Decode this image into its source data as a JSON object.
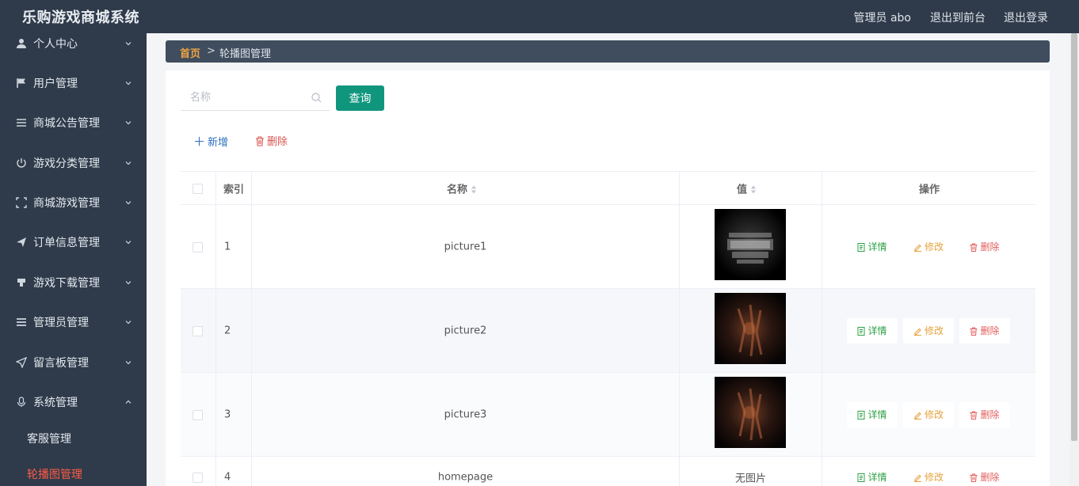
{
  "header": {
    "app_title": "乐购游戏商城系统",
    "admin_label": "管理员 abo",
    "front_link": "退出到前台",
    "logout_link": "退出登录"
  },
  "sidebar": {
    "items": [
      {
        "label": "个人中心",
        "icon": "user-icon"
      },
      {
        "label": "用户管理",
        "icon": "flag-icon"
      },
      {
        "label": "商城公告管理",
        "icon": "list-icon"
      },
      {
        "label": "游戏分类管理",
        "icon": "power-icon"
      },
      {
        "label": "商城游戏管理",
        "icon": "fullscreen-icon"
      },
      {
        "label": "订单信息管理",
        "icon": "send-icon"
      },
      {
        "label": "游戏下载管理",
        "icon": "download-icon"
      },
      {
        "label": "管理员管理",
        "icon": "menu-icon"
      },
      {
        "label": "留言板管理",
        "icon": "navigation-icon"
      },
      {
        "label": "系统管理",
        "icon": "microphone-icon",
        "expanded": true
      }
    ],
    "sub_items": [
      {
        "label": "客服管理"
      },
      {
        "label": "轮播图管理",
        "active": true
      }
    ],
    "active_color": "#ff5b43"
  },
  "breadcrumb": {
    "home": "首页",
    "separator": ">",
    "current": "轮播图管理"
  },
  "search": {
    "placeholder": "名称",
    "value": "",
    "button_label": "查询"
  },
  "actions": {
    "add_label": "新增",
    "delete_label": "删除"
  },
  "table": {
    "columns": [
      "索引",
      "名称",
      "值",
      "操作"
    ],
    "rows": [
      {
        "index": "1",
        "name": "picture1",
        "image": "call-of-duty-ghosts-logo",
        "value": ""
      },
      {
        "index": "2",
        "name": "picture2",
        "image": "dark-game-art",
        "value": ""
      },
      {
        "index": "3",
        "name": "picture3",
        "image": "dark-game-art",
        "value": ""
      },
      {
        "index": "4",
        "name": "homepage",
        "image": null,
        "value": "无图片"
      }
    ],
    "op_labels": {
      "detail": "详情",
      "edit": "修改",
      "remove": "删除"
    }
  },
  "colors": {
    "header_bg": "#2f3b4b",
    "primary_button": "#11967e",
    "breadcrumb_home": "#f0a442",
    "detail": "#2ea046",
    "edit": "#e6a23c",
    "remove": "#e35c5c"
  }
}
